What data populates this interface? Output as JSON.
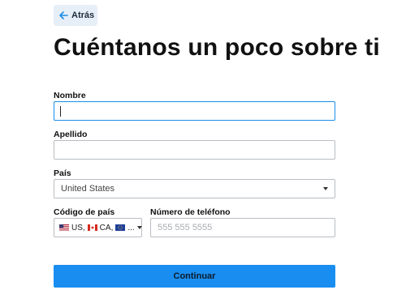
{
  "back_button": {
    "label": "Atrás"
  },
  "title": "Cuéntanos un poco sobre ti",
  "form": {
    "first_name": {
      "label": "Nombre",
      "value": ""
    },
    "last_name": {
      "label": "Apellido",
      "value": ""
    },
    "country": {
      "label": "País",
      "selected": "United States"
    },
    "country_code": {
      "label": "Código de país",
      "items": [
        {
          "code": "US,",
          "flag": "us-flag-icon"
        },
        {
          "code": "CA,",
          "flag": "ca-flag-icon"
        },
        {
          "code": "...",
          "flag": "eu-flag-icon"
        }
      ]
    },
    "phone": {
      "label": "Número de teléfono",
      "placeholder": "555 555 5555"
    }
  },
  "continue_button": {
    "label": "Continuar"
  },
  "colors": {
    "accent": "#1a8ef0",
    "focus_border": "#1a8ee8",
    "back_bg": "#e6eef7"
  }
}
